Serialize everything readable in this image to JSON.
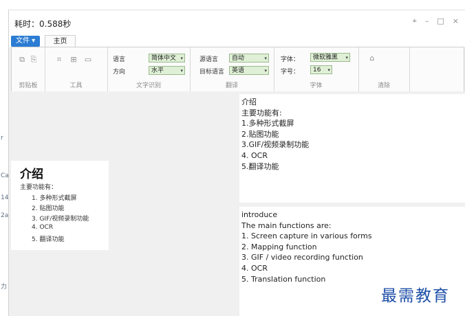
{
  "window": {
    "title": "耗时：0.588秒"
  },
  "controls": {
    "pin": "⌖",
    "minimize": "–",
    "maximize": "□",
    "close": "×"
  },
  "tabs": {
    "file": "文件 ▾",
    "home": "主页"
  },
  "ribbon": {
    "groups": {
      "clipboard": "剪贴板",
      "tools": "工具",
      "ocr": "文字识别",
      "translate": "翻译",
      "font": "字体",
      "clear": "清除"
    },
    "ocr": {
      "language_label": "语言",
      "language_value": "简体中文",
      "direction_label": "方向",
      "direction_value": "水平"
    },
    "translate": {
      "source_label": "源语言",
      "source_value": "自动",
      "target_label": "目标语言",
      "target_value": "英语"
    },
    "font": {
      "font_label": "字体：",
      "font_value": "微软雅黑",
      "size_label": "字号：",
      "size_value": "16"
    },
    "icons": [
      "copy-icon",
      "paste-icon",
      "scan-icon",
      "grid-icon",
      "image-icon",
      "eraser-icon"
    ]
  },
  "overlay": {
    "title": "介绍",
    "intro": "主要功能有：",
    "items": [
      "1. 多种形式截屏",
      "2. 贴图功能",
      "3. GIF/视频录制功能",
      "4. OCR",
      "5. 翻译功能"
    ]
  },
  "source_pane": {
    "lines": [
      "介绍",
      "主要功能有:",
      "1.多种形式截屏",
      "2.贴图功能",
      "3.GIF/视频录制功能",
      "4. OCR",
      "5.翻译功能"
    ]
  },
  "target_pane": {
    "lines": [
      "introduce",
      "The main functions are:",
      "1. Screen capture in various forms",
      "2. Mapping function",
      "3. GIF / video recording function",
      "4. OCR",
      "5. Translation function"
    ]
  },
  "watermark": "最需教育",
  "colors": {
    "file_button": "#2b7cd3",
    "combo_bg": "#dff0d6",
    "watermark": "#1e4fa8"
  }
}
